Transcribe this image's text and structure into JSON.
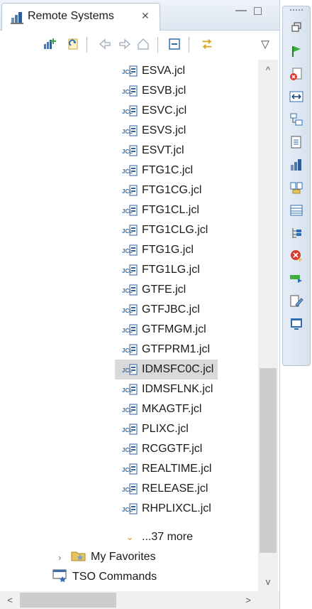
{
  "view": {
    "tab_title": "Remote Systems",
    "tab_close_symbol": "✕",
    "minimize_symbol": "—",
    "maximize_symbol": "□",
    "view_menu_symbol": "▽"
  },
  "toolbar": {
    "icons": [
      "new-connection-icon",
      "refresh-icon",
      "back-icon",
      "forward-icon",
      "home-icon",
      "collapse-all-icon",
      "link-with-editor-icon"
    ]
  },
  "tree": {
    "files": [
      "ESVA.jcl",
      "ESVB.jcl",
      "ESVC.jcl",
      "ESVS.jcl",
      "ESVT.jcl",
      "FTG1C.jcl",
      "FTG1CG.jcl",
      "FTG1CL.jcl",
      "FTG1CLG.jcl",
      "FTG1G.jcl",
      "FTG1LG.jcl",
      "GTFE.jcl",
      "GTFJBC.jcl",
      "GTFMGM.jcl",
      "GTFPRM1.jcl",
      "IDMSFC0C.jcl",
      "IDMSFLNK.jcl",
      "MKAGTF.jcl",
      "PLIXC.jcl",
      "RCGGTF.jcl",
      "REALTIME.jcl",
      "RELEASE.jcl",
      "RHPLIXCL.jcl"
    ],
    "selected": "IDMSFC0C.jcl",
    "file_icon_text": "JCL",
    "more_label": "...37 more",
    "favorites_label": "My Favorites",
    "tso_label": "TSO Commands"
  },
  "scrollbars": {
    "up": "^",
    "down": "v",
    "left": "<",
    "right": ">"
  },
  "side_toolbar": {
    "icons": [
      "restore-icon",
      "flag-icon",
      "error-log-icon",
      "resize-icon",
      "outline-icon",
      "properties-icon",
      "remote-systems-icon",
      "compare-icon",
      "table-icon",
      "tree-icon",
      "problems-icon",
      "run-icon",
      "edit-icon",
      "console-icon"
    ]
  },
  "colors": {
    "selection": "#d9d9d9",
    "tab_border": "#b9c5d4",
    "icon_blue": "#2f6fb1"
  }
}
